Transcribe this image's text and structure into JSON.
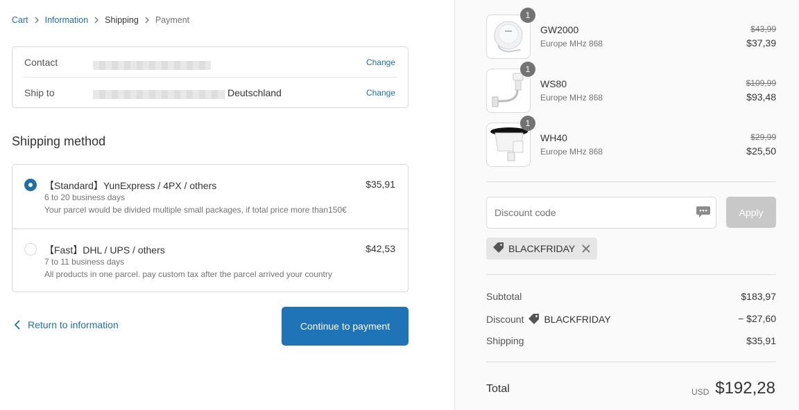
{
  "breadcrumb": {
    "items": [
      "Cart",
      "Information",
      "Shipping",
      "Payment"
    ]
  },
  "review": {
    "contact_label": "Contact",
    "contact_change": "Change",
    "ship_label": "Ship to",
    "ship_country": "Deutschland",
    "ship_change": "Change"
  },
  "shipping": {
    "title": "Shipping method",
    "methods": [
      {
        "title": "【Standard】YunExpress / 4PX / others",
        "price": "$35,91",
        "days": "6 to 20 business days",
        "note": "Your parcel would be divided multiple small packages, if total price more than150€",
        "selected": true
      },
      {
        "title": "【Fast】DHL / UPS / others",
        "price": "$42,53",
        "days": "7 to 11 business days",
        "note": "All products in one parcel. pay custom tax after the parcel arrived your country",
        "selected": false
      }
    ]
  },
  "nav": {
    "return_label": "Return to information",
    "continue_label": "Continue to payment"
  },
  "cart": {
    "products": [
      {
        "name": "GW2000",
        "variant": "Europe MHz 868",
        "old_price": "$43,99",
        "price": "$37,39",
        "qty": "1"
      },
      {
        "name": "WS80",
        "variant": "Europe MHz 868",
        "old_price": "$109,99",
        "price": "$93,48",
        "qty": "1"
      },
      {
        "name": "WH40",
        "variant": "Europe MHz 868",
        "old_price": "$29,99",
        "price": "$25,50",
        "qty": "1"
      }
    ],
    "discount_placeholder": "Discount code",
    "apply_label": "Apply",
    "applied_code": "BLACKFRIDAY",
    "subtotal_label": "Subtotal",
    "subtotal": "$183,97",
    "discount_label": "Discount",
    "discount_code": "BLACKFRIDAY",
    "discount_value": "− $27,60",
    "shipping_label": "Shipping",
    "shipping_value": "$35,91",
    "total_label": "Total",
    "currency": "USD",
    "total": "$192,28"
  },
  "colors": {
    "accent": "#1f73b7",
    "link": "#1f6fa8",
    "sidebar_bg": "#fafafa",
    "apply_disabled": "#c8c8c8"
  },
  "icons": {
    "breadcrumb_separator": "chevron-right-icon",
    "return": "chevron-left-icon",
    "discount_field": "chat-bubble-icon",
    "tag": "tag-icon",
    "remove": "close-icon"
  }
}
